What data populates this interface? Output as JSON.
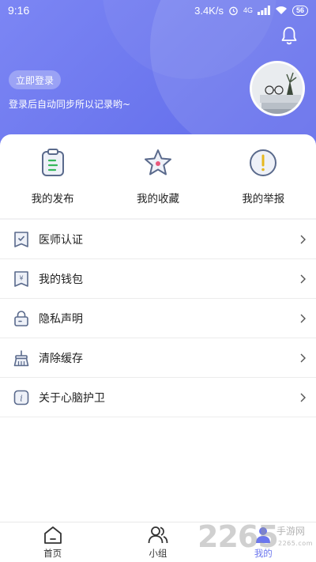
{
  "status_bar": {
    "time": "9:16",
    "net_speed": "3.4K/s",
    "network": "4G",
    "battery": "56"
  },
  "header": {
    "login_button": "立即登录",
    "login_hint": "登录后自动同步所以记录哟~",
    "icons": {
      "notification": "bell-icon"
    }
  },
  "quick_actions": [
    {
      "label": "我的发布",
      "icon": "clipboard-icon"
    },
    {
      "label": "我的收藏",
      "icon": "star-icon"
    },
    {
      "label": "我的举报",
      "icon": "report-icon"
    }
  ],
  "menu": [
    {
      "label": "医师认证",
      "icon": "certificate-icon"
    },
    {
      "label": "我的钱包",
      "icon": "wallet-icon"
    },
    {
      "label": "隐私声明",
      "icon": "lock-icon"
    },
    {
      "label": "清除缓存",
      "icon": "broom-icon"
    },
    {
      "label": "关于心脑护卫",
      "icon": "info-icon"
    }
  ],
  "tabbar": [
    {
      "label": "首页",
      "icon": "home-icon",
      "active": false
    },
    {
      "label": "小组",
      "icon": "group-icon",
      "active": false
    },
    {
      "label": "我的",
      "icon": "profile-icon",
      "active": true
    }
  ],
  "watermark": {
    "number": "2265",
    "text": "手游网",
    "sub": "2265.com"
  },
  "colors": {
    "accent": "#6b76ee",
    "hero_start": "#7c86f4",
    "hero_end": "#5f69ea",
    "icon_blue": "#5a6a8c",
    "icon_yellow": "#e6b81e"
  }
}
